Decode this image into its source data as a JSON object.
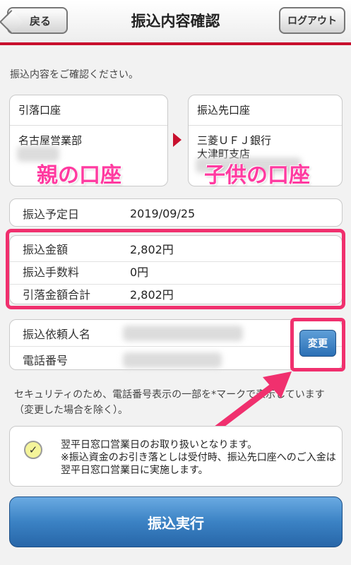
{
  "header": {
    "back_label": "戻る",
    "title": "振込内容確認",
    "logout_label": "ログアウト"
  },
  "instruction": "振込内容をご確認ください。",
  "from_account": {
    "heading": "引落口座",
    "branch": "名古屋営業部",
    "annotation": "親の口座"
  },
  "to_account": {
    "heading": "振込先口座",
    "bank": "三菱ＵＦＪ銀行",
    "branch": "大津町支店",
    "annotation": "子供の口座"
  },
  "schedule": {
    "label": "振込予定日",
    "value": "2019/09/25"
  },
  "amounts": [
    {
      "label": "振込金額",
      "value": "2,802円"
    },
    {
      "label": "振込手数料",
      "value": "0円"
    },
    {
      "label": "引落金額合計",
      "value": "2,802円"
    }
  ],
  "requester": {
    "name_label": "振込依頼人名",
    "phone_label": "電話番号",
    "change_label": "変更"
  },
  "security_notice": "セキュリティのため、電話番号表示の一部を*マークで表示しています（変更した場合を除く）。",
  "info": {
    "line1": "翌平日窓口営業日のお取り扱いとなります。",
    "line2": "※振込資金のお引き落としは受付時、振込先口座へのご入金は翌平日窓口営業日に実施します。"
  },
  "execute_label": "振込実行",
  "colors": {
    "accent_red": "#c8102e",
    "highlight_pink": "#f0306e",
    "button_blue": "#2a6fb5"
  },
  "icons": {
    "check": "check-icon",
    "arrow": "caret-right-icon"
  }
}
